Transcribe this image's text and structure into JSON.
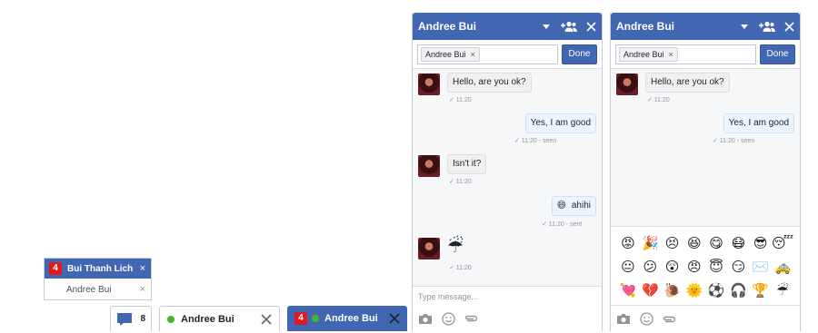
{
  "overflow_list": {
    "items": [
      {
        "badge": "4",
        "name": "Bui Thanh Lich",
        "close": "×"
      },
      {
        "badge": "",
        "name": "Andree Bui",
        "close": "×"
      }
    ]
  },
  "dock": {
    "count_tab": {
      "count": "8"
    },
    "tab1": {
      "name": "Andree Bui"
    },
    "tab2": {
      "badge": "4",
      "name": "Andree Bui"
    }
  },
  "chat1": {
    "title": "Andree Bui",
    "token": "Andree Bui",
    "token_close": "×",
    "done": "Done",
    "placeholder": "Type message...",
    "messages": [
      {
        "from": "them",
        "text": "Hello, are you ok?",
        "meta": "✓ 11:20"
      },
      {
        "from": "me",
        "text": "Yes, I am good",
        "meta": "✓ 11:20 - seen"
      },
      {
        "from": "them",
        "text": "Isn't it?",
        "meta": "✓ 11:20"
      },
      {
        "from": "me",
        "text": "ahihi",
        "emoji": "😄",
        "meta": "✓ 11:20 - sent"
      },
      {
        "from": "them",
        "text": "☔",
        "meta": "✓ 11:20"
      }
    ]
  },
  "chat2": {
    "title": "Andree Bui",
    "token": "Andree Bui",
    "token_close": "×",
    "done": "Done",
    "messages": [
      {
        "from": "them",
        "text": "Hello, are you ok?",
        "meta": "✓ 11:20"
      },
      {
        "from": "me",
        "text": "Yes, I am good",
        "meta": "✓ 11:20 - seen"
      }
    ],
    "emojis": [
      "😡",
      "🎉",
      "😣",
      "😆",
      "😋",
      "😷",
      "😎",
      "😴",
      "😐",
      "😕",
      "😲",
      "😠",
      "😇",
      "😏",
      "✉️",
      "🚕",
      "💘",
      "💔",
      "🐌",
      "🌞",
      "⚽",
      "🎧",
      "🏆",
      "☔"
    ]
  },
  "colors": {
    "brand": "#4267b2",
    "badge": "#e0191d",
    "online": "#42b72a"
  }
}
